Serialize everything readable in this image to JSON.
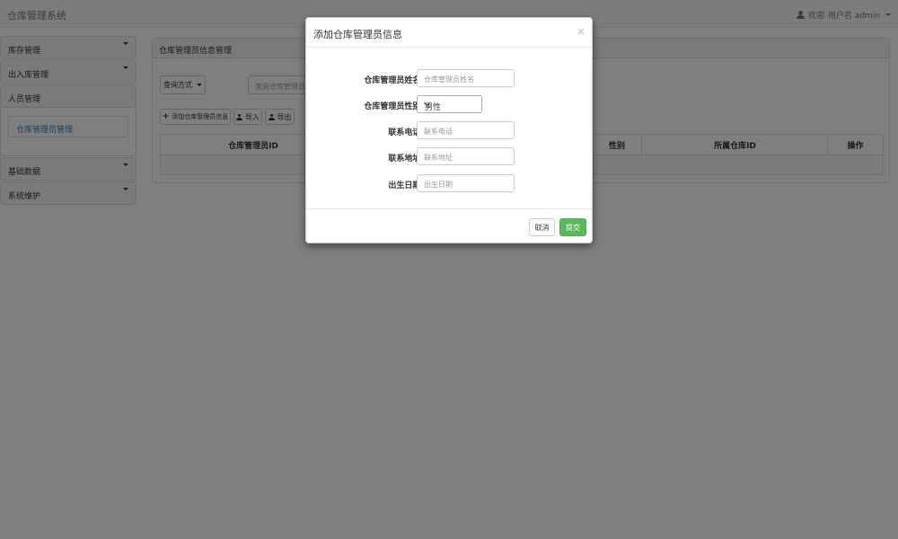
{
  "navbar": {
    "brand": "仓库管理系统",
    "welcome": "欢迎",
    "user_label": "用户名 admin"
  },
  "sidebar": {
    "items": [
      {
        "label": "库存管理"
      },
      {
        "label": "出入库管理"
      },
      {
        "label": "人员管理"
      },
      {
        "label": "基础数据"
      },
      {
        "label": "系统维护"
      }
    ],
    "subitem": "仓库管理员管理"
  },
  "panel": {
    "title": "仓库管理员信息管理",
    "query_button": "查询方式",
    "search_placeholder": "查询仓库管理员信息",
    "add_button": "添加仓库管理员信息",
    "import_button": "导入",
    "export_button": "导出",
    "columns": [
      "仓库管理员ID",
      "性别",
      "所属仓库ID",
      "操作"
    ]
  },
  "modal": {
    "title": "添加仓库管理员信息",
    "close": "×",
    "fields": [
      {
        "label": "仓库管理员姓名:",
        "placeholder": "仓库管理员姓名"
      },
      {
        "label": "仓库管理员性别:",
        "value": "男性"
      },
      {
        "label": "联系电话:",
        "placeholder": "联系电话"
      },
      {
        "label": "联系地址:",
        "placeholder": "联系地址"
      },
      {
        "label": "出生日期:",
        "placeholder": "出生日期"
      }
    ],
    "cancel": "取消",
    "submit": "提交"
  },
  "colors": {
    "submit": "#5cb85c",
    "link": "#337ab7"
  }
}
